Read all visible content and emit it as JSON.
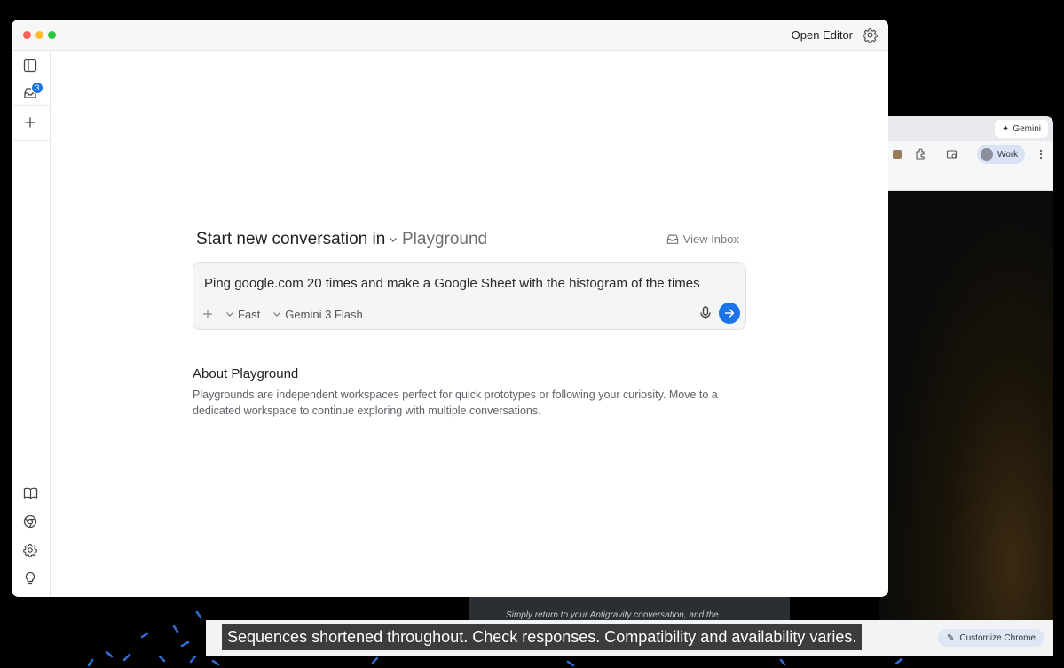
{
  "window": {
    "open_editor_label": "Open Editor",
    "inbox_badge_count": "3"
  },
  "main": {
    "start_label": "Start new conversation in",
    "workspace_name": "Playground",
    "view_inbox_label": "View Inbox",
    "prompt_value": "Ping google.com 20 times and make a Google Sheet with the histogram of the times",
    "mode_label": "Fast",
    "model_label": "Gemini 3 Flash",
    "about_title": "About Playground",
    "about_body": "Playgrounds are independent workspaces perfect for quick prototypes or following your curiosity. Move to a dedicated workspace to continue exploring with multiple conversations."
  },
  "background": {
    "gemini_label": "Gemini",
    "profile_label": "Work",
    "customize_label": "Customize Chrome",
    "doc_text": "Simply return to your Antigravity conversation, and the",
    "caption": "Sequences shortened throughout. Check responses. Compatibility and availability varies."
  },
  "colors": {
    "accent": "#1a73e8",
    "traffic_red": "#fe5f57",
    "traffic_yellow": "#febc2e",
    "traffic_green": "#28c840"
  }
}
